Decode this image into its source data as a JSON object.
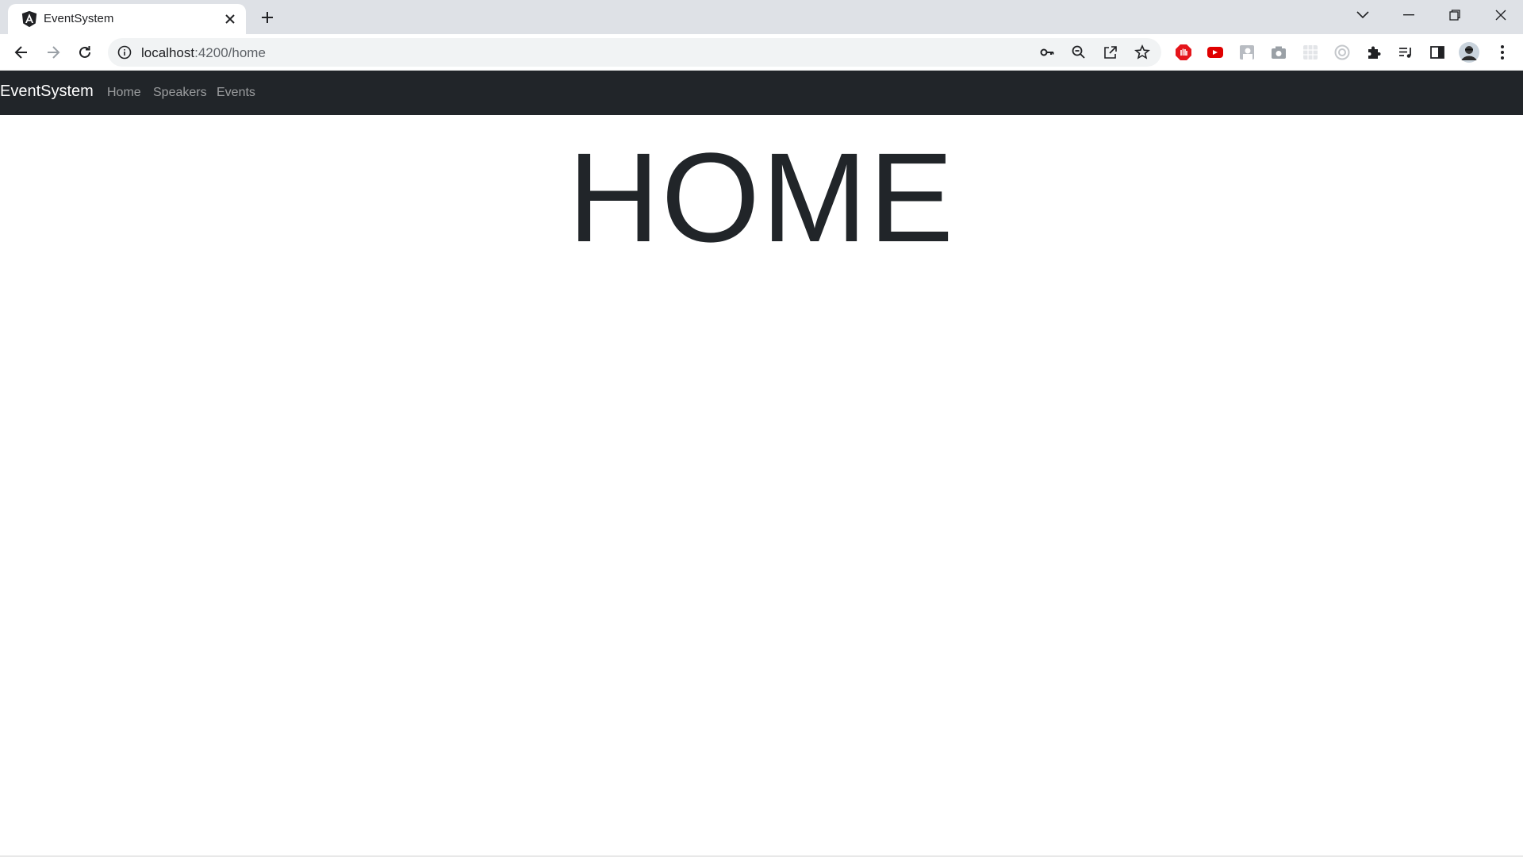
{
  "browser": {
    "tab": {
      "title": "EventSystem"
    },
    "address": {
      "host": "localhost",
      "rest": ":4200/home"
    }
  },
  "app": {
    "brand": "EventSystem",
    "nav": [
      {
        "label": "Home"
      },
      {
        "label": "Speakers"
      },
      {
        "label": "Events"
      }
    ]
  },
  "page": {
    "heading": "HOME"
  },
  "colors": {
    "navbar_bg": "#212529",
    "heading": "#212529",
    "tabstrip_bg": "#dee1e6"
  }
}
